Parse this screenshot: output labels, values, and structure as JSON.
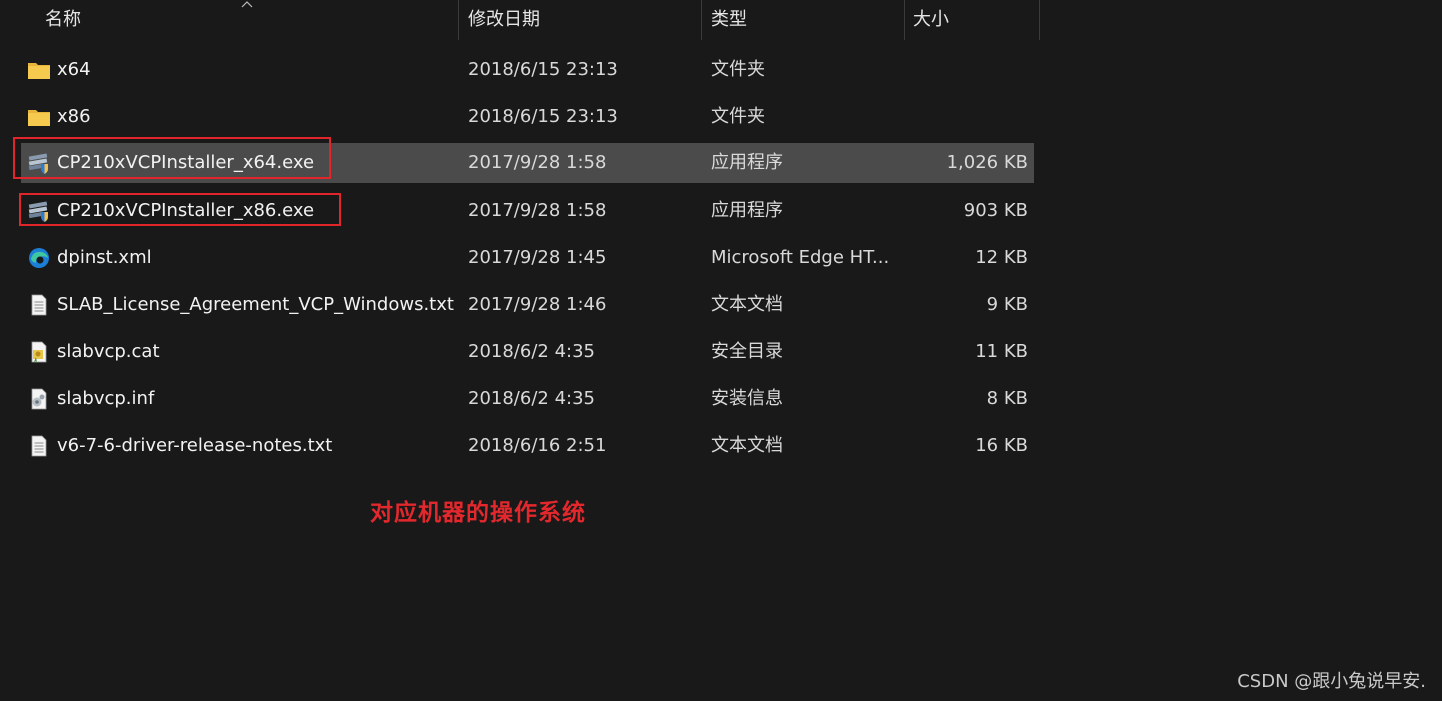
{
  "columns": {
    "name": "名称",
    "date": "修改日期",
    "type": "类型",
    "size": "大小"
  },
  "files": [
    {
      "name": "x64",
      "date": "2018/6/15 23:13",
      "type": "文件夹",
      "size": "",
      "icon": "folder-icon"
    },
    {
      "name": "x86",
      "date": "2018/6/15 23:13",
      "type": "文件夹",
      "size": "",
      "icon": "folder-icon"
    },
    {
      "name": "CP210xVCPInstaller_x64.exe",
      "date": "2017/9/28 1:58",
      "type": "应用程序",
      "size": "1,026 KB",
      "icon": "installer-icon",
      "selected": true
    },
    {
      "name": "CP210xVCPInstaller_x86.exe",
      "date": "2017/9/28 1:58",
      "type": "应用程序",
      "size": "903 KB",
      "icon": "installer-icon"
    },
    {
      "name": "dpinst.xml",
      "date": "2017/9/28 1:45",
      "type": "Microsoft Edge HT...",
      "size": "12 KB",
      "icon": "edge-icon"
    },
    {
      "name": "SLAB_License_Agreement_VCP_Windows.txt",
      "date": "2017/9/28 1:46",
      "type": "文本文档",
      "size": "9 KB",
      "icon": "text-file-icon"
    },
    {
      "name": "slabvcp.cat",
      "date": "2018/6/2 4:35",
      "type": "安全目录",
      "size": "11 KB",
      "icon": "security-catalog-icon"
    },
    {
      "name": "slabvcp.inf",
      "date": "2018/6/2 4:35",
      "type": "安装信息",
      "size": "8 KB",
      "icon": "setup-info-icon"
    },
    {
      "name": "v6-7-6-driver-release-notes.txt",
      "date": "2018/6/16 2:51",
      "type": "文本文档",
      "size": "16 KB",
      "icon": "text-file-icon"
    }
  ],
  "annotation": "对应机器的操作系统",
  "watermark": "CSDN @跟小兔说早安.",
  "colors": {
    "background": "#191919",
    "selected_row": "#4b4b4b",
    "highlight": "#e0262b",
    "folder": "#f2c14e"
  }
}
